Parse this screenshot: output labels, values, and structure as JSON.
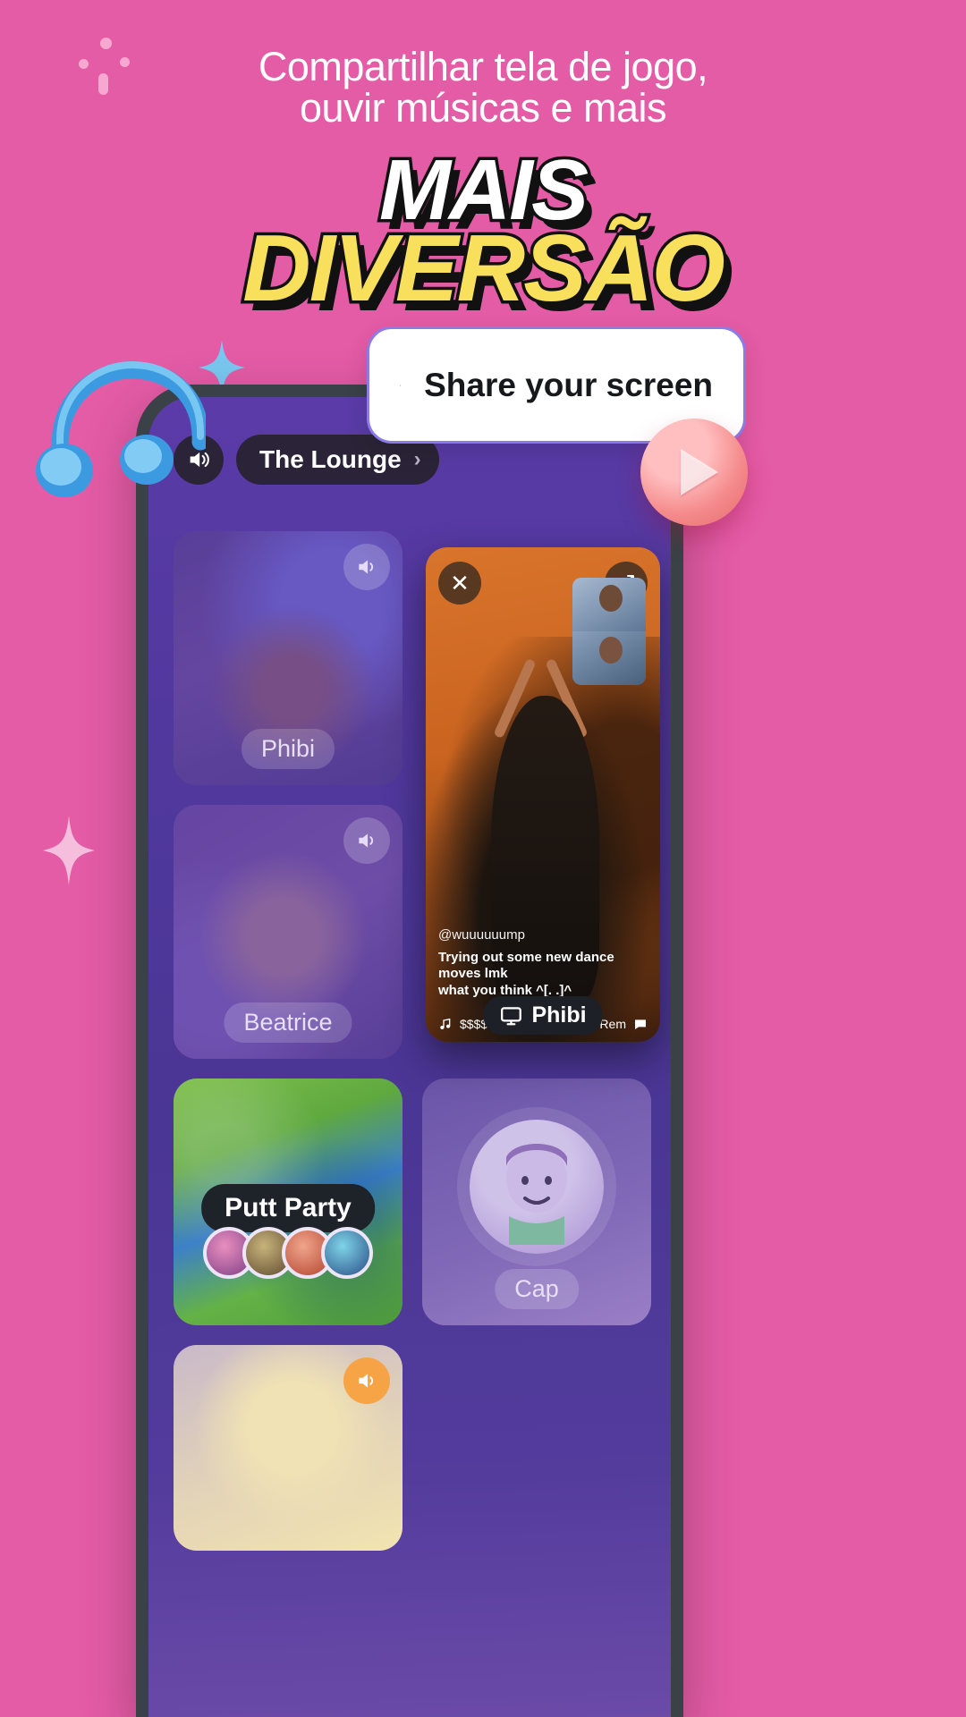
{
  "theme": {
    "background_pink": "#E45BA6",
    "headline_yellow": "#F8E05C",
    "headline_white": "#FFFFFF",
    "outline_black": "#111111",
    "callout_border": "#8A7BE8",
    "phone_body": "#3A4147"
  },
  "hero": {
    "subtitle_line1": "Compartilhar tela de jogo,",
    "subtitle_line2": "ouvir músicas e mais",
    "headline_line1": "MAIS",
    "headline_line2": "DIVERSÃO"
  },
  "callout": {
    "label": "Share your screen",
    "icon": "screen-share-icon"
  },
  "decor": {
    "play_button_icon": "play-icon",
    "headphones_icon": "headphones-icon",
    "sparkle_icon": "sparkle-icon",
    "dot_cluster_icon": "dot-cluster-icon"
  },
  "phone": {
    "topbar": {
      "speaker_icon": "volume-on-icon",
      "room_name": "The Lounge",
      "chevron": "›"
    },
    "tiles": [
      {
        "name": "Phibi",
        "type": "participant",
        "mic_icon": "volume-on-icon",
        "mic": true
      },
      {
        "name": "Beatrice",
        "type": "participant",
        "mic_icon": "volume-on-icon",
        "mic": true
      },
      {
        "name": "Putt Party",
        "type": "game",
        "player_count": 4
      },
      {
        "name": "Cap",
        "type": "participant",
        "mic": false
      },
      {
        "name": "",
        "type": "participant",
        "mic_icon": "volume-on-icon",
        "mic": true
      }
    ],
    "video_overlay": {
      "close_icon": "close-icon",
      "expand_icon": "expand-icon",
      "handle": "@wuuuuuump",
      "caption_line1": "Trying out some new dance moves lmk",
      "caption_line2": "what you think ^[. .]^",
      "music_icon": "music-note-icon",
      "track": "$$$$Machine (Nightcore Remix)",
      "comment_icon": "comment-icon",
      "host_pill_icon": "screen-share-icon",
      "host_pill_label": "Phibi"
    }
  }
}
